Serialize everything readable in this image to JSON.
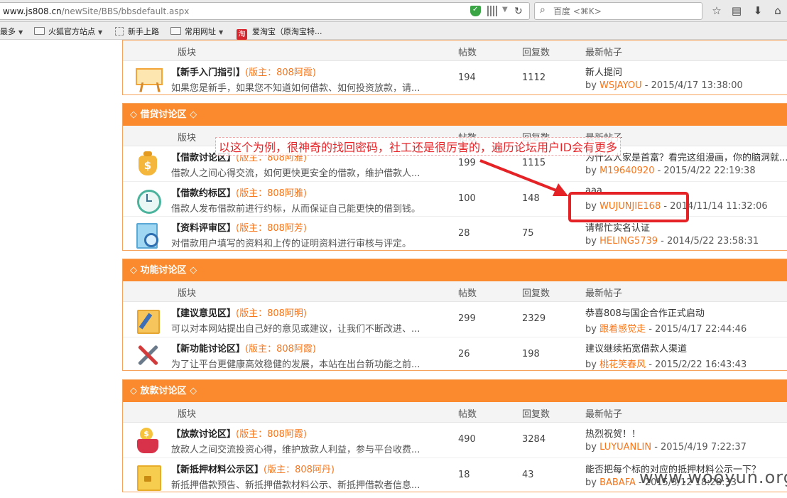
{
  "browser": {
    "url_host": "www.js808.cn",
    "url_path": "/newSite/BBS/bbsdefault.aspx",
    "search_placeholder": "百度 <⌘K>"
  },
  "bookmarks": [
    {
      "label": "最多"
    },
    {
      "label": "火狐官方站点"
    },
    {
      "label": "新手上路"
    },
    {
      "label": "常用网址"
    },
    {
      "label": "爱淘宝（原淘宝特..."
    }
  ],
  "columns": {
    "board": "版块",
    "posts": "帖数",
    "replies": "回复数",
    "latest": "最新帖子"
  },
  "sections": [
    {
      "title": "",
      "boards": [
        {
          "name": "【新手入门指引】",
          "moderator": "(版主：808阿霞)",
          "desc": "如果您是新手，如果您不知道如何借款、如何投资放款，请...",
          "posts": "194",
          "replies": "1112",
          "latest_title": "新人提问",
          "by": "by ",
          "user": "WSJAYOU",
          "time": " - 2015/4/17 13:38:00",
          "icon": "easel-icon"
        }
      ]
    },
    {
      "title": "借贷讨论区",
      "boards": [
        {
          "name": "【借款讨论区】",
          "moderator": "(版主：808阿雅)",
          "desc": "借款人之间心得交流，如何更快更安全的借款，维护借款人...",
          "posts": "199",
          "replies": "1115",
          "latest_title": "为什么人家是首富？看完这组漫画，你的脑洞就...",
          "by": "by ",
          "user": "M19640920",
          "time": " - 2015/4/22 22:19:38",
          "icon": "money-bag-icon"
        },
        {
          "name": "【借款约标区】",
          "moderator": "(版主：808阿雅)",
          "desc": "借款人发布借款前进行约标，从而保证自己能更快的借到钱。",
          "posts": "100",
          "replies": "148",
          "latest_title": "aaa",
          "by": "by ",
          "user": "WUJUNJIE168",
          "time": " - 2014/11/14 11:32:06",
          "icon": "alarm-clock-icon"
        },
        {
          "name": "【资料评审区】",
          "moderator": "(版主：808阿芳)",
          "desc": "对借款用户填写的资料和上传的证明资料进行审核与评定。",
          "posts": "28",
          "replies": "75",
          "latest_title": "请帮忙实名认证",
          "by": "by ",
          "user": "HELING5739",
          "time": " - 2014/5/22 23:58:31",
          "icon": "document-search-icon"
        }
      ]
    },
    {
      "title": "功能讨论区",
      "boards": [
        {
          "name": "【建议意见区】",
          "moderator": "(版主：808阿明)",
          "desc": "可以对本网站提出自己好的意见或建议，让我们不断改进、...",
          "posts": "299",
          "replies": "2329",
          "latest_title": "恭喜808与国企合作正式启动",
          "by": "by ",
          "user": "跟着感觉走",
          "time": " - 2015/4/17 22:44:46",
          "icon": "note-pencil-icon"
        },
        {
          "name": "【新功能讨论区】",
          "moderator": "(版主：808阿霞)",
          "desc": "为了让平台更健康高效稳健的发展，本站在出台新功能之前...",
          "posts": "26",
          "replies": "198",
          "latest_title": "建议继续拓宽借款人渠道",
          "by": "by ",
          "user": "桃花笑春风",
          "time": " - 2015/2/22 16:43:43",
          "icon": "tools-icon"
        }
      ]
    },
    {
      "title": "放款讨论区",
      "boards": [
        {
          "name": "【放款讨论区】",
          "moderator": "(版主：808阿霞)",
          "desc": "放款人之间交流投资心得，维护放款人利益，参与平台收费...",
          "posts": "490",
          "replies": "3284",
          "latest_title": "热烈祝贺！！",
          "by": "by ",
          "user": "LUYUANLIN",
          "time": " - 2015/4/19 7:22:37",
          "icon": "coin-bag-icon"
        },
        {
          "name": "【新抵押材料公示区】",
          "moderator": "(版主：808阿丹)",
          "desc": "新抵押借款预告、新抵押借款材料公示、新抵押借款者信息...",
          "posts": "18",
          "replies": "43",
          "latest_title": "能否把每个标的对应的抵押材料公示一下？",
          "by": "by ",
          "user": "BABAFA",
          "time": " - 2015/3/12 18:28:33",
          "icon": "folder-icon"
        }
      ]
    }
  ],
  "annotation": {
    "text": "以这个为例，很神奇的找回密码，社工还是很厉害的，遍历论坛用户ID会有更多",
    "color": "#e52327"
  },
  "watermark": "www.wooyun.org",
  "colors": {
    "accent": "#fb8a2e",
    "link": "#f7751a"
  }
}
